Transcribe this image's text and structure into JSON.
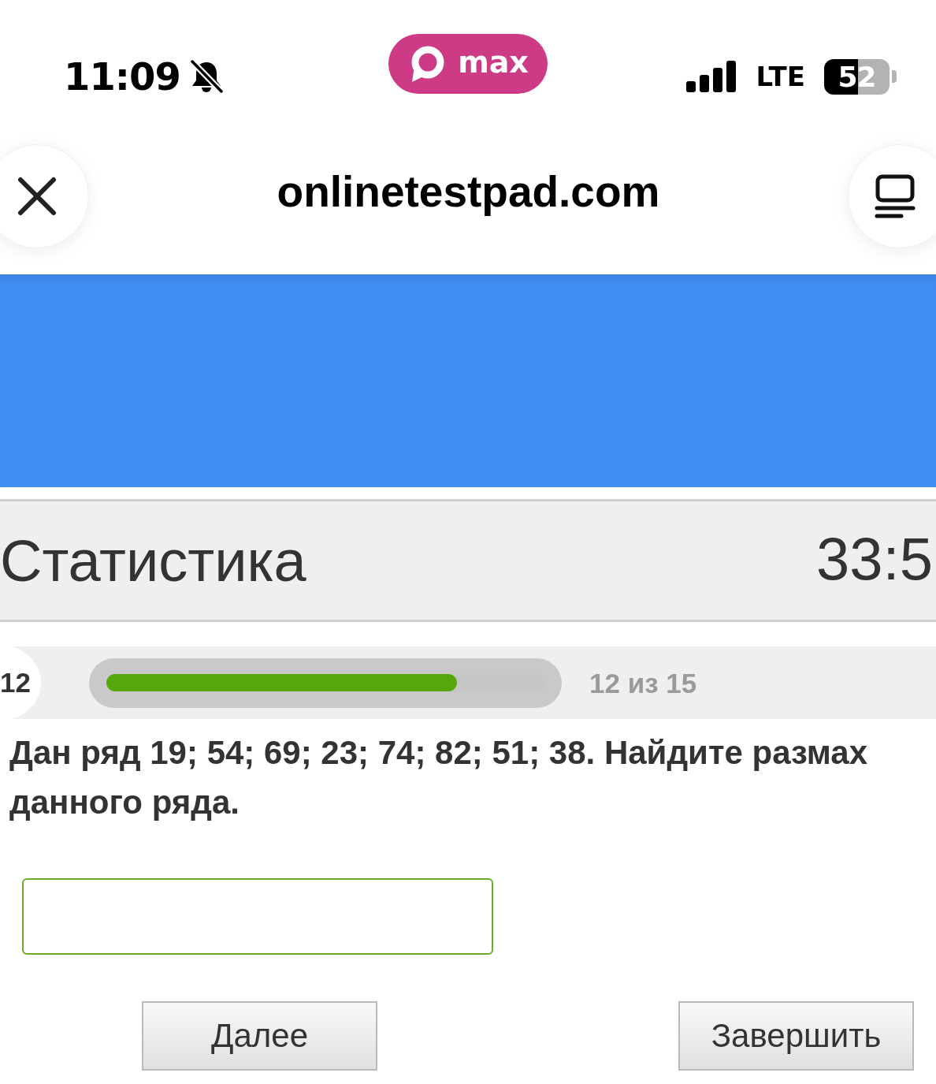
{
  "status_bar": {
    "time": "11:09",
    "muted": true,
    "app": {
      "name": "max"
    },
    "network": "LTE",
    "battery": "52"
  },
  "browser_bar": {
    "title": "onlinetestpad.com"
  },
  "test_header": {
    "title": "Статистика",
    "timer": "33:5"
  },
  "progress": {
    "question_number": "12",
    "level": 0.8,
    "reading": "12 из 15"
  },
  "question": {
    "text": "Дан ряд 19; 54; 69; 23; 74; 82; 51; 38. Найдите размах данного ряда."
  },
  "buttons": [
    {
      "label": "Далее"
    },
    {
      "label": "Завершить"
    }
  ]
}
